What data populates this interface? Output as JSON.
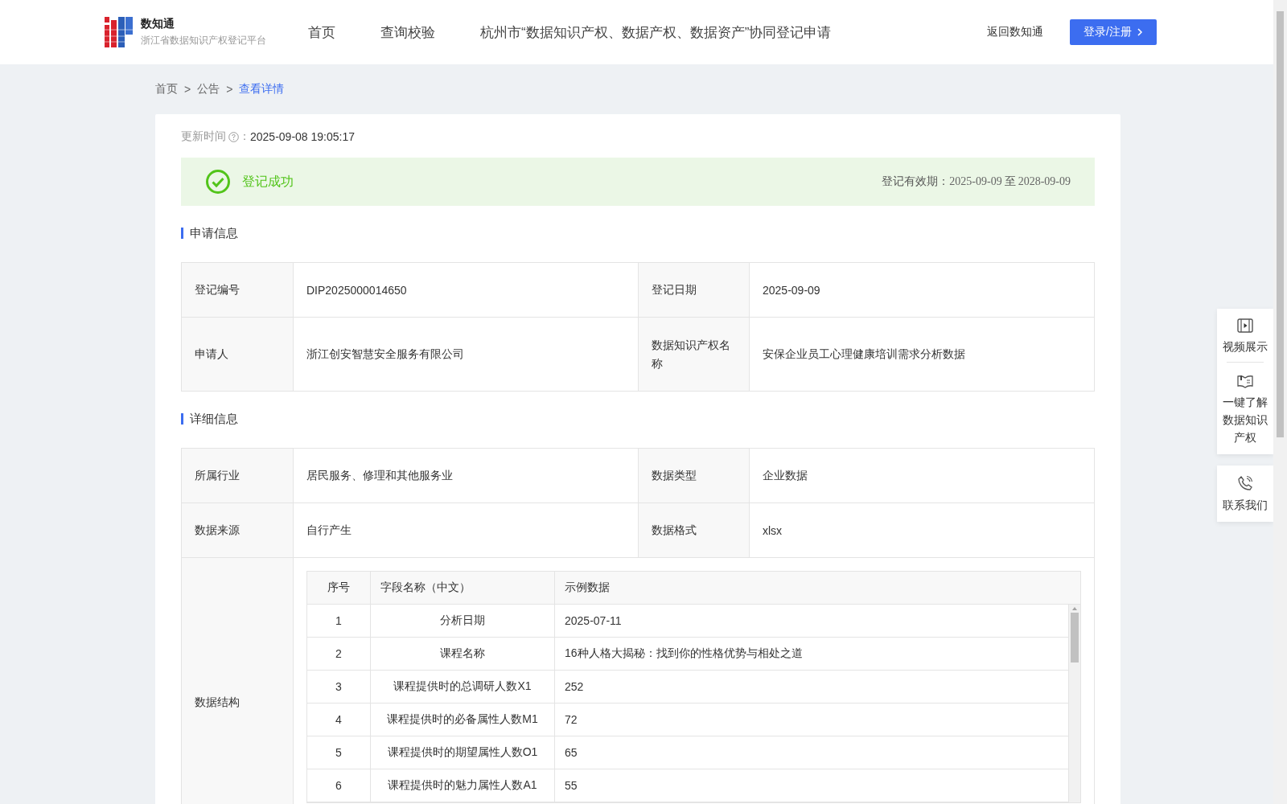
{
  "header": {
    "logo": {
      "name": "数知通",
      "subtitle": "浙江省数据知识产权登记平台"
    },
    "nav": [
      {
        "label": "首页",
        "selected": false
      },
      {
        "label": "查询校验",
        "selected": false
      },
      {
        "label": "杭州市“数据知识产权、数据产权、数据资产”协同登记申请",
        "selected": false
      }
    ],
    "back_link": "返回数知通",
    "login_button": "登录/注册"
  },
  "breadcrumb": {
    "items": [
      {
        "label": "首页",
        "selected": false
      },
      {
        "label": "公告",
        "selected": false
      },
      {
        "label": "查看详情",
        "selected": true
      }
    ],
    "separators": [
      ">",
      ">"
    ]
  },
  "update_time": {
    "label": "更新时间",
    "colon": "：",
    "value": "2025-09-08 19:05:17"
  },
  "status": {
    "kind": "success",
    "text": "登记成功",
    "validity_label": "登记有效期：",
    "valid_from": "2025-09-09",
    "to": "至",
    "valid_until": "2028-09-09"
  },
  "application": {
    "title": "申请信息",
    "rows": [
      [
        {
          "label": "登记编号",
          "value": "DIP2025000014650"
        },
        {
          "label": "登记日期",
          "value": "2025-09-09"
        }
      ],
      [
        {
          "label": "申请人",
          "value": "浙江创安智慧安全服务有限公司"
        },
        {
          "label": "数据知识产权名称",
          "value": "安保企业员工心理健康培训需求分析数据"
        }
      ]
    ]
  },
  "details": {
    "title": "详细信息",
    "rows": [
      [
        {
          "label": "所属行业",
          "value": "居民服务、修理和其他服务业"
        },
        {
          "label": "数据类型",
          "value": "企业数据"
        }
      ],
      [
        {
          "label": "数据来源",
          "value": "自行产生"
        },
        {
          "label": "数据格式",
          "value": "xlsx"
        }
      ]
    ],
    "structure": {
      "label": "数据结构",
      "columns": [
        "序号",
        "字段名称（中文）",
        "示例数据"
      ],
      "rows": [
        [
          "1",
          "分析日期",
          "2025-07-11"
        ],
        [
          "2",
          "课程名称",
          "16种人格大揭秘：找到你的性格优势与相处之道"
        ],
        [
          "3",
          "课程提供时的总调研人数X1",
          "252"
        ],
        [
          "4",
          "课程提供时的必备属性人数M1",
          "72"
        ],
        [
          "5",
          "课程提供时的期望属性人数O1",
          "65"
        ],
        [
          "6",
          "课程提供时的魅力属性人数A1",
          "55"
        ]
      ]
    }
  },
  "side_panel": [
    {
      "kind": "video",
      "label": "视频展示"
    },
    {
      "kind": "book",
      "label": "一键了解数据知识产权"
    }
  ],
  "contact": {
    "kind": "phone",
    "label": "联系我们"
  }
}
